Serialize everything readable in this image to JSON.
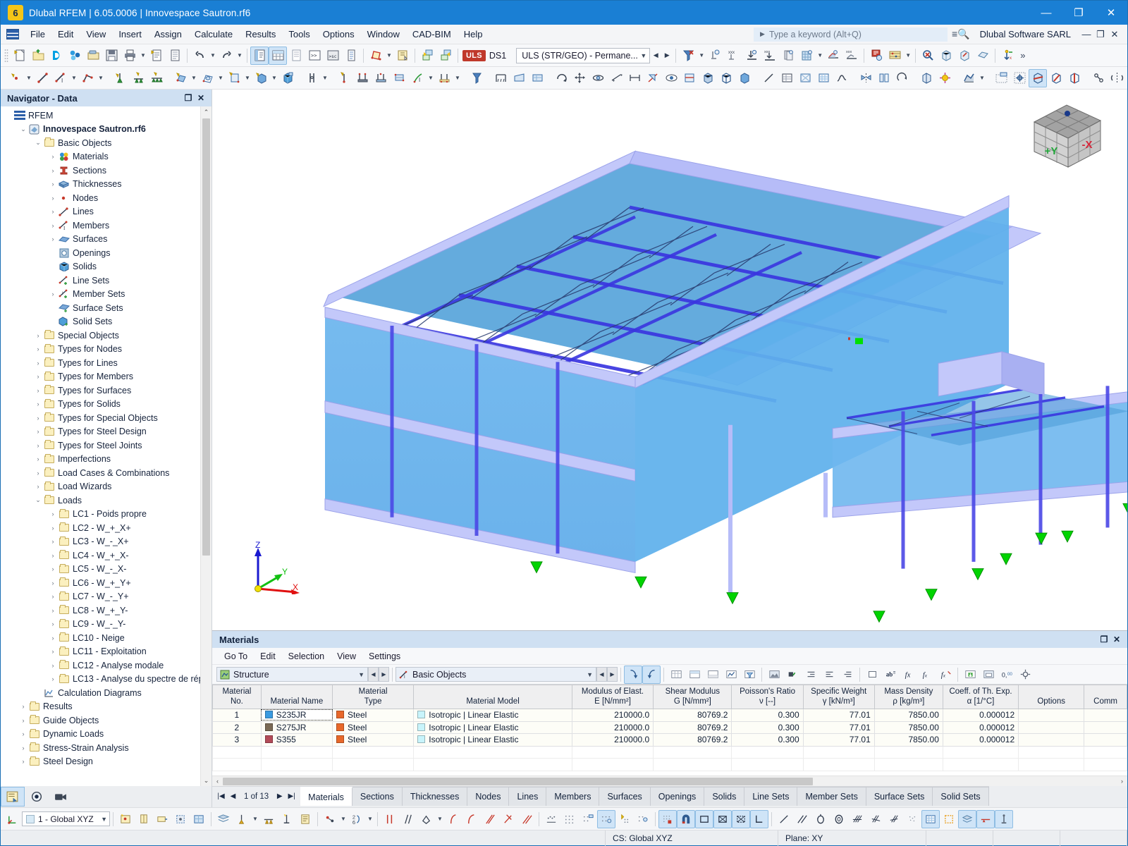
{
  "titlebar": {
    "title": "Dlubal RFEM | 6.05.0006 | Innovespace Sautron.rf6",
    "minimize": "—",
    "maximize": "❐",
    "close": "✕"
  },
  "menubar": {
    "items": [
      "File",
      "Edit",
      "View",
      "Insert",
      "Assign",
      "Calculate",
      "Results",
      "Tools",
      "Options",
      "Window",
      "CAD-BIM",
      "Help"
    ],
    "search_placeholder": "Type a keyword (Alt+Q)",
    "org": "Dlubal Software SARL",
    "mini_minimize": "—",
    "mini_restore": "❐",
    "mini_close": "✕"
  },
  "toolbar": {
    "uls_badge": "ULS",
    "design_situation": "DS1",
    "combination": "ULS (STR/GEO) - Permane...",
    "overflow": "»"
  },
  "navigator": {
    "title": "Navigator - Data",
    "float_glyph": "❐",
    "close_glyph": "✕",
    "scroll_up": "⌃",
    "scroll_down": "⌄",
    "tree": [
      {
        "label": "RFEM",
        "indent": 0,
        "twist": "",
        "icon": "rfem-logo-icon",
        "bold": false
      },
      {
        "label": "Innovespace Sautron.rf6",
        "indent": 1,
        "twist": "⌄",
        "icon": "model-icon",
        "bold": true
      },
      {
        "label": "Basic Objects",
        "indent": 2,
        "twist": "⌄",
        "icon": "folder-icon",
        "bold": false
      },
      {
        "label": "Materials",
        "indent": 3,
        "twist": "›",
        "icon": "materials-icon",
        "bold": false
      },
      {
        "label": "Sections",
        "indent": 3,
        "twist": "›",
        "icon": "sections-icon",
        "bold": false
      },
      {
        "label": "Thicknesses",
        "indent": 3,
        "twist": "›",
        "icon": "thickness-icon",
        "bold": false
      },
      {
        "label": "Nodes",
        "indent": 3,
        "twist": "›",
        "icon": "node-icon",
        "bold": false
      },
      {
        "label": "Lines",
        "indent": 3,
        "twist": "›",
        "icon": "line-icon",
        "bold": false
      },
      {
        "label": "Members",
        "indent": 3,
        "twist": "›",
        "icon": "member-icon",
        "bold": false
      },
      {
        "label": "Surfaces",
        "indent": 3,
        "twist": "›",
        "icon": "surface-icon",
        "bold": false
      },
      {
        "label": "Openings",
        "indent": 3,
        "twist": "",
        "icon": "opening-icon",
        "bold": false
      },
      {
        "label": "Solids",
        "indent": 3,
        "twist": "",
        "icon": "solid-icon",
        "bold": false
      },
      {
        "label": "Line Sets",
        "indent": 3,
        "twist": "",
        "icon": "line-set-icon",
        "bold": false
      },
      {
        "label": "Member Sets",
        "indent": 3,
        "twist": "›",
        "icon": "member-set-icon",
        "bold": false
      },
      {
        "label": "Surface Sets",
        "indent": 3,
        "twist": "",
        "icon": "surface-set-icon",
        "bold": false
      },
      {
        "label": "Solid Sets",
        "indent": 3,
        "twist": "",
        "icon": "solid-set-icon",
        "bold": false
      },
      {
        "label": "Special Objects",
        "indent": 2,
        "twist": "›",
        "icon": "folder-icon",
        "bold": false
      },
      {
        "label": "Types for Nodes",
        "indent": 2,
        "twist": "›",
        "icon": "folder-icon",
        "bold": false
      },
      {
        "label": "Types for Lines",
        "indent": 2,
        "twist": "›",
        "icon": "folder-icon",
        "bold": false
      },
      {
        "label": "Types for Members",
        "indent": 2,
        "twist": "›",
        "icon": "folder-icon",
        "bold": false
      },
      {
        "label": "Types for Surfaces",
        "indent": 2,
        "twist": "›",
        "icon": "folder-icon",
        "bold": false
      },
      {
        "label": "Types for Solids",
        "indent": 2,
        "twist": "›",
        "icon": "folder-icon",
        "bold": false
      },
      {
        "label": "Types for Special Objects",
        "indent": 2,
        "twist": "›",
        "icon": "folder-icon",
        "bold": false
      },
      {
        "label": "Types for Steel Design",
        "indent": 2,
        "twist": "›",
        "icon": "folder-icon",
        "bold": false
      },
      {
        "label": "Types for Steel Joints",
        "indent": 2,
        "twist": "›",
        "icon": "folder-icon",
        "bold": false
      },
      {
        "label": "Imperfections",
        "indent": 2,
        "twist": "›",
        "icon": "folder-icon",
        "bold": false
      },
      {
        "label": "Load Cases & Combinations",
        "indent": 2,
        "twist": "›",
        "icon": "folder-icon",
        "bold": false
      },
      {
        "label": "Load Wizards",
        "indent": 2,
        "twist": "›",
        "icon": "folder-icon",
        "bold": false
      },
      {
        "label": "Loads",
        "indent": 2,
        "twist": "⌄",
        "icon": "folder-icon",
        "bold": false
      },
      {
        "label": "LC1 - Poids propre",
        "indent": 3,
        "twist": "›",
        "icon": "folder-icon",
        "bold": false
      },
      {
        "label": "LC2 - W_+_X+",
        "indent": 3,
        "twist": "›",
        "icon": "folder-icon",
        "bold": false
      },
      {
        "label": "LC3 - W_-_X+",
        "indent": 3,
        "twist": "›",
        "icon": "folder-icon",
        "bold": false
      },
      {
        "label": "LC4 - W_+_X-",
        "indent": 3,
        "twist": "›",
        "icon": "folder-icon",
        "bold": false
      },
      {
        "label": "LC5 - W_-_X-",
        "indent": 3,
        "twist": "›",
        "icon": "folder-icon",
        "bold": false
      },
      {
        "label": "LC6 - W_+_Y+",
        "indent": 3,
        "twist": "›",
        "icon": "folder-icon",
        "bold": false
      },
      {
        "label": "LC7 - W_-_Y+",
        "indent": 3,
        "twist": "›",
        "icon": "folder-icon",
        "bold": false
      },
      {
        "label": "LC8 - W_+_Y-",
        "indent": 3,
        "twist": "›",
        "icon": "folder-icon",
        "bold": false
      },
      {
        "label": "LC9 - W_-_Y-",
        "indent": 3,
        "twist": "›",
        "icon": "folder-icon",
        "bold": false
      },
      {
        "label": "LC10 - Neige",
        "indent": 3,
        "twist": "›",
        "icon": "folder-icon",
        "bold": false
      },
      {
        "label": "LC11 - Exploitation",
        "indent": 3,
        "twist": "›",
        "icon": "folder-icon",
        "bold": false
      },
      {
        "label": "LC12 - Analyse modale",
        "indent": 3,
        "twist": "›",
        "icon": "folder-icon",
        "bold": false
      },
      {
        "label": "LC13 - Analyse du spectre de rép",
        "indent": 3,
        "twist": "›",
        "icon": "folder-icon",
        "bold": false
      },
      {
        "label": "Calculation Diagrams",
        "indent": 2,
        "twist": "",
        "icon": "diagram-icon",
        "bold": false
      },
      {
        "label": "Results",
        "indent": 1,
        "twist": "›",
        "icon": "folder-icon",
        "bold": false
      },
      {
        "label": "Guide Objects",
        "indent": 1,
        "twist": "›",
        "icon": "folder-icon",
        "bold": false
      },
      {
        "label": "Dynamic Loads",
        "indent": 1,
        "twist": "›",
        "icon": "folder-icon",
        "bold": false
      },
      {
        "label": "Stress-Strain Analysis",
        "indent": 1,
        "twist": "›",
        "icon": "folder-icon",
        "bold": false
      },
      {
        "label": "Steel Design",
        "indent": 1,
        "twist": "›",
        "icon": "folder-icon",
        "bold": false
      }
    ]
  },
  "viewport": {
    "nav_cube_labels": {
      "front": "+Y",
      "right": "-X"
    },
    "axis_labels": {
      "z": "Z",
      "y": "Y",
      "x": "X"
    },
    "colors": {
      "surface_fill": "#6ab4ea",
      "roof_fill": "#4f9fd8",
      "member_edge": "#b0b6f7",
      "member_strong": "#3a36e0",
      "support_green": "#00d400",
      "background": "#ffffff"
    }
  },
  "materials_panel": {
    "title": "Materials",
    "float_glyph": "❐",
    "close_glyph": "✕",
    "menu": [
      "Go To",
      "Edit",
      "Selection",
      "View",
      "Settings"
    ],
    "combo_left": "Structure",
    "combo_right": "Basic Objects",
    "columns": [
      {
        "l1": "Material",
        "l2": "No."
      },
      {
        "l1": "",
        "l2": "Material Name"
      },
      {
        "l1": "Material",
        "l2": "Type"
      },
      {
        "l1": "",
        "l2": "Material Model"
      },
      {
        "l1": "Modulus of Elast.",
        "l2": "E [N/mm²]"
      },
      {
        "l1": "Shear Modulus",
        "l2": "G [N/mm²]"
      },
      {
        "l1": "Poisson's Ratio",
        "l2": "ν [--]"
      },
      {
        "l1": "Specific Weight",
        "l2": "γ [kN/m³]"
      },
      {
        "l1": "Mass Density",
        "l2": "ρ [kg/m³]"
      },
      {
        "l1": "Coeff. of Th. Exp.",
        "l2": "α [1/°C]"
      },
      {
        "l1": "",
        "l2": "Options"
      },
      {
        "l1": "",
        "l2": "Comm"
      }
    ],
    "rows": [
      {
        "no": "1",
        "name": "S235JR",
        "name_color": "#3a9ae0",
        "type": "Steel",
        "type_color": "#e8682a",
        "model": "Isotropic | Linear Elastic",
        "model_color": "#c8f4fb",
        "E": "210000.0",
        "G": "80769.2",
        "nu": "0.300",
        "gamma": "77.01",
        "rho": "7850.00",
        "alpha": "0.000012",
        "options": "",
        "comment": "",
        "selected": true
      },
      {
        "no": "2",
        "name": "S275JR",
        "name_color": "#7a6a56",
        "type": "Steel",
        "type_color": "#e8682a",
        "model": "Isotropic | Linear Elastic",
        "model_color": "#c8f4fb",
        "E": "210000.0",
        "G": "80769.2",
        "nu": "0.300",
        "gamma": "77.01",
        "rho": "7850.00",
        "alpha": "0.000012",
        "options": "",
        "comment": "",
        "selected": false
      },
      {
        "no": "3",
        "name": "S355",
        "name_color": "#b24a58",
        "type": "Steel",
        "type_color": "#e8682a",
        "model": "Isotropic | Linear Elastic",
        "model_color": "#c8f4fb",
        "E": "210000.0",
        "G": "80769.2",
        "nu": "0.300",
        "gamma": "77.01",
        "rho": "7850.00",
        "alpha": "0.000012",
        "options": "",
        "comment": "",
        "selected": false
      }
    ],
    "hscroll_left": "‹",
    "hscroll_right": "›"
  },
  "tabs": {
    "pager": {
      "first": "|◀",
      "prev": "◀",
      "info": "1 of 13",
      "next": "▶",
      "last": "▶|"
    },
    "items": [
      "Materials",
      "Sections",
      "Thicknesses",
      "Nodes",
      "Lines",
      "Members",
      "Surfaces",
      "Openings",
      "Solids",
      "Line Sets",
      "Member Sets",
      "Surface Sets",
      "Solid Sets"
    ],
    "active": "Materials"
  },
  "statusbar": {
    "coordinate_system": "1 - Global XYZ",
    "cs_text": "CS: Global XYZ",
    "plane_text": "Plane: XY"
  }
}
